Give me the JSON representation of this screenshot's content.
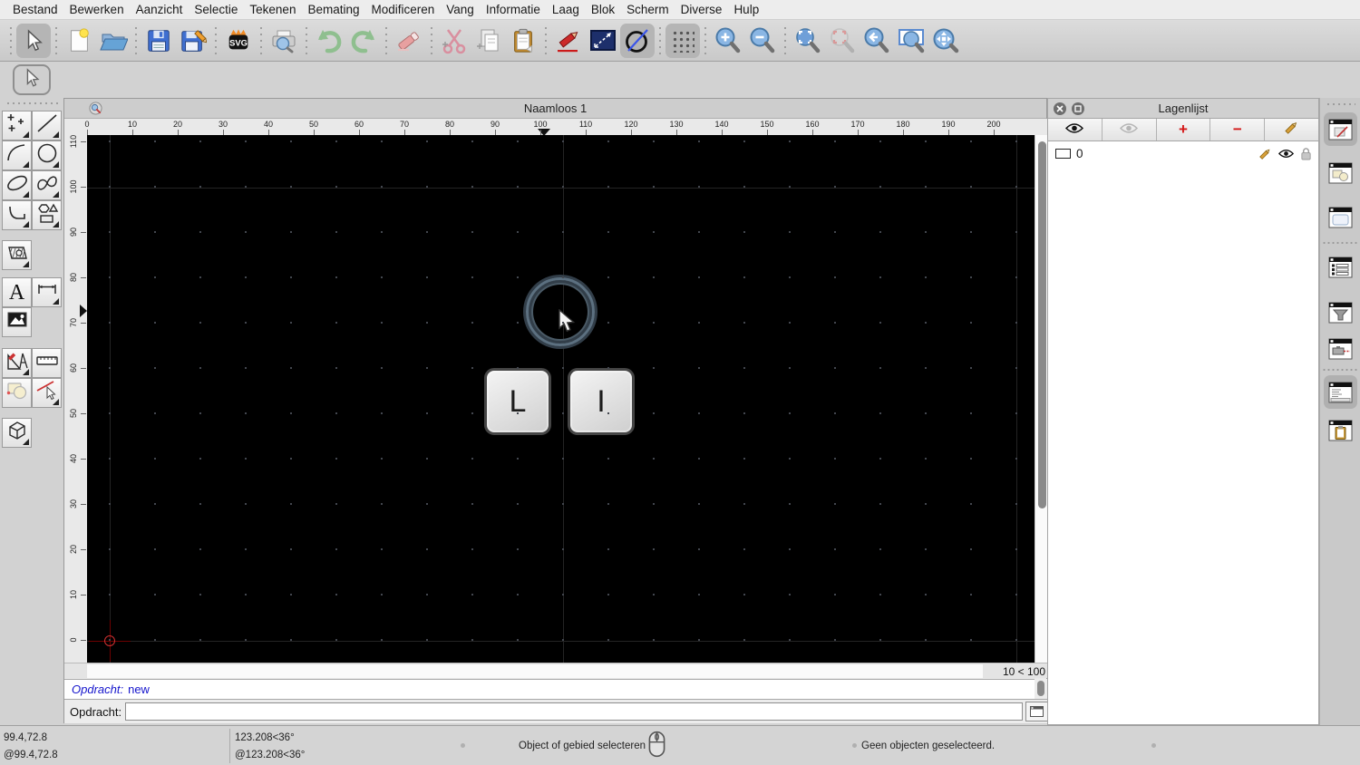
{
  "menu": {
    "items": [
      "Bestand",
      "Bewerken",
      "Aanzicht",
      "Selectie",
      "Tekenen",
      "Bemating",
      "Modificeren",
      "Vang",
      "Informatie",
      "Laag",
      "Blok",
      "Scherm",
      "Diverse",
      "Hulp"
    ]
  },
  "toolbar": {
    "buttons": [
      "select",
      "new-document",
      "open",
      "save",
      "save-as",
      "svg-export",
      "print-preview",
      "undo",
      "redo",
      "erase",
      "cut",
      "copy",
      "paste",
      "draw",
      "line-style",
      "circle-diameter",
      "grid",
      "zoom-in",
      "zoom-out",
      "zoom-extents",
      "zoom-selection",
      "zoom-previous",
      "zoom-window",
      "pan"
    ],
    "svg_badge_label": "SVG"
  },
  "tool_palette": {
    "tools": [
      "select",
      "points",
      "line",
      "arc",
      "circle",
      "ellipse",
      "spline",
      "polyline",
      "shapes",
      "hatch",
      "text",
      "dimension",
      "image",
      "construction",
      "measure",
      "shape-edit",
      "trim",
      "box-3d"
    ],
    "text_tool_glyph": "A"
  },
  "document": {
    "title": "Naamloos 1",
    "ruler_h_ticks": [
      0,
      10,
      20,
      30,
      40,
      50,
      60,
      70,
      80,
      90,
      100,
      110,
      120,
      130,
      140,
      150,
      160,
      170,
      180,
      190,
      200
    ],
    "ruler_v_ticks": [
      0,
      10,
      20,
      30,
      40,
      50,
      60,
      70,
      80,
      90,
      100,
      110
    ],
    "scale_indicator": "10 < 100",
    "key_overlays": [
      "L",
      "I"
    ]
  },
  "layers_panel": {
    "title": "Lagenlijst",
    "toolbar": [
      "show-layer",
      "show-layer-dim",
      "add-layer",
      "remove-layer",
      "edit-layer"
    ],
    "add_glyph": "+",
    "remove_glyph": "−",
    "layers": [
      {
        "name": "0"
      }
    ]
  },
  "command": {
    "history_label": "Opdracht:",
    "history_value": "new",
    "prompt_label": "Opdracht:",
    "input_value": ""
  },
  "right_dock": {
    "palettes": [
      "layers",
      "properties",
      "pages",
      "list",
      "filter",
      "tools",
      "command",
      "clipboard"
    ]
  },
  "status_bar": {
    "coords_abs": "99.4,72.8",
    "coords_rel": "@99.4,72.8",
    "polar_abs": "123.208<36°",
    "polar_rel": "@123.208<36°",
    "hint": "Object of gebied selecteren",
    "selection_status": "Geen objecten geselecteerd."
  },
  "colors": {
    "canvas_bg": "#000000",
    "grid_dot": "#43474f",
    "snap_ring": "#5c7080",
    "command_text": "#1414cc",
    "origin_marker": "#cf3030",
    "accent_blue": "#3f6fd1"
  }
}
